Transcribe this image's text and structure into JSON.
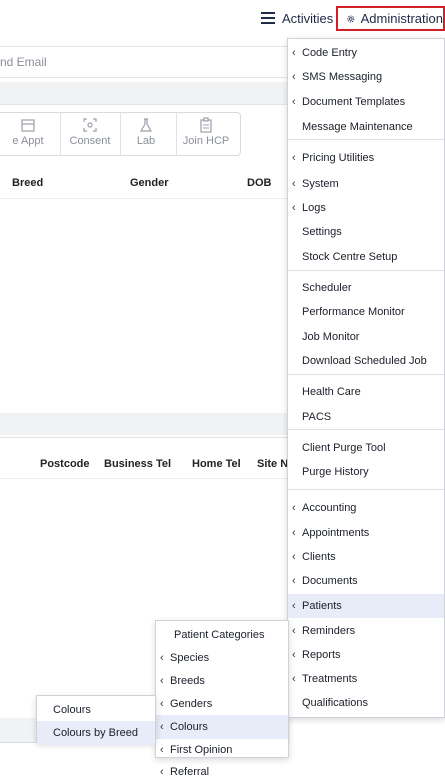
{
  "topbar": {
    "activities_label": "Activities",
    "activities_icon": "list-icon",
    "admin_label": "Administration",
    "admin_icon": "gear-icon",
    "admin_border_color": "#d51f26"
  },
  "background": {
    "email_label": "nd Email",
    "toolbar": [
      "e Appt",
      "Consent",
      "Lab",
      "Join HCP"
    ],
    "grid_headers": [
      "Breed",
      "Gender",
      "DOB"
    ],
    "grid2_headers": [
      "Postcode",
      "Business Tel",
      "Home Tel",
      "Site N"
    ]
  },
  "admin_menu": {
    "items": [
      {
        "label": "Code Entry",
        "submenu": true
      },
      {
        "label": "SMS Messaging",
        "submenu": true
      },
      {
        "label": "Document Templates",
        "submenu": true
      },
      {
        "label": "Message Maintenance",
        "submenu": false
      },
      {
        "label": "Pricing Utilities",
        "submenu": true
      },
      {
        "label": "System",
        "submenu": true
      },
      {
        "label": "Logs",
        "submenu": true
      },
      {
        "label": "Settings",
        "submenu": false
      },
      {
        "label": "Stock Centre Setup",
        "submenu": false
      },
      {
        "label": "Scheduler",
        "submenu": false
      },
      {
        "label": "Performance Monitor",
        "submenu": false
      },
      {
        "label": "Job Monitor",
        "submenu": false
      },
      {
        "label": "Download Scheduled Job",
        "submenu": false
      },
      {
        "label": "Health Care",
        "submenu": false
      },
      {
        "label": "PACS",
        "submenu": false
      },
      {
        "label": "Client Purge Tool",
        "submenu": false
      },
      {
        "label": "Purge History",
        "submenu": false
      },
      {
        "label": "Accounting",
        "submenu": true
      },
      {
        "label": "Appointments",
        "submenu": true
      },
      {
        "label": "Clients",
        "submenu": true
      },
      {
        "label": "Documents",
        "submenu": true
      },
      {
        "label": "Patients",
        "submenu": true,
        "selected": true
      },
      {
        "label": "Reminders",
        "submenu": true
      },
      {
        "label": "Reports",
        "submenu": true
      },
      {
        "label": "Treatments",
        "submenu": true
      },
      {
        "label": "Qualifications",
        "submenu": false
      }
    ]
  },
  "patients_menu": {
    "items": [
      {
        "label": "Patient Categories",
        "submenu": false
      },
      {
        "label": "Species",
        "submenu": true
      },
      {
        "label": "Breeds",
        "submenu": true
      },
      {
        "label": "Genders",
        "submenu": true
      },
      {
        "label": "Colours",
        "submenu": true,
        "selected": true
      },
      {
        "label": "First Opinion",
        "submenu": true
      },
      {
        "label": "Referral",
        "submenu": true
      }
    ]
  },
  "colours_menu": {
    "items": [
      {
        "label": "Colours"
      },
      {
        "label": "Colours by Breed",
        "selected": true
      }
    ]
  }
}
